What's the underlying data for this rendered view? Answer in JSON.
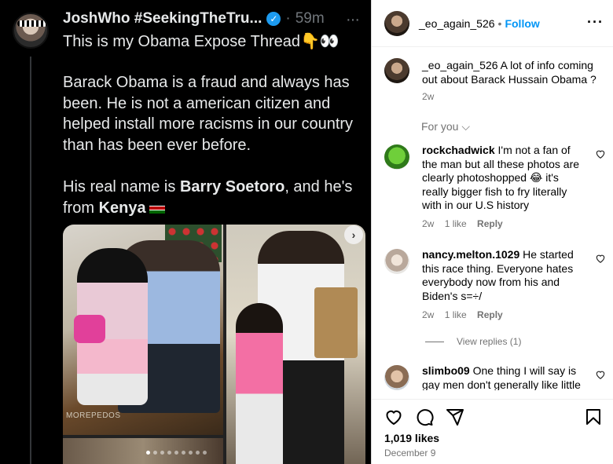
{
  "tweet": {
    "author_name": "JoshWho #SeekingTheTru...",
    "time": "59m",
    "more": "···",
    "title": "This is my Obama Expose Thread👇👀",
    "paragraph1": "Barack Obama is a fraud and always has been. He is not a american citizen and helped install more racisms in our country than has been ever before.",
    "p2_prefix": "His real name is ",
    "p2_name": "Barry Soetoro",
    "p2_middle": ", and he's from ",
    "p2_country": "Kenya",
    "watermark": "MOREPEDOS",
    "carousel_slides": 9,
    "carousel_active": 1
  },
  "post": {
    "username": "_eo_again_526",
    "follow_label": "Follow",
    "options_icon": "more-options-icon",
    "caption_user": "_eo_again_526",
    "caption_text": "A lot of info coming out about Barack Hussain Obama ?",
    "caption_age": "2w",
    "for_you_label": "For you"
  },
  "comments": [
    {
      "user": "rockchadwick",
      "text": "I'm not a fan of the man but all these photos are clearly photoshopped 😂 it's really bigger fish to fry literally with in our U.S history",
      "age": "2w",
      "likes": "1 like",
      "reply": "Reply"
    },
    {
      "user": "nancy.melton.1029",
      "text": "He started this race thing. Everyone hates everybody now from his and Biden's s=÷/",
      "age": "2w",
      "likes": "1 like",
      "reply": "Reply",
      "view_replies": "View replies (1)"
    },
    {
      "user": "slimbo09",
      "text": "One thing I will say is gay men don't generally like little"
    }
  ],
  "footer": {
    "likes": "1,019 likes",
    "date": "December 9"
  },
  "colors": {
    "link_blue": "#0095f6",
    "twitter_verified": "#1d9bf0",
    "muted_gray": "#737373"
  }
}
